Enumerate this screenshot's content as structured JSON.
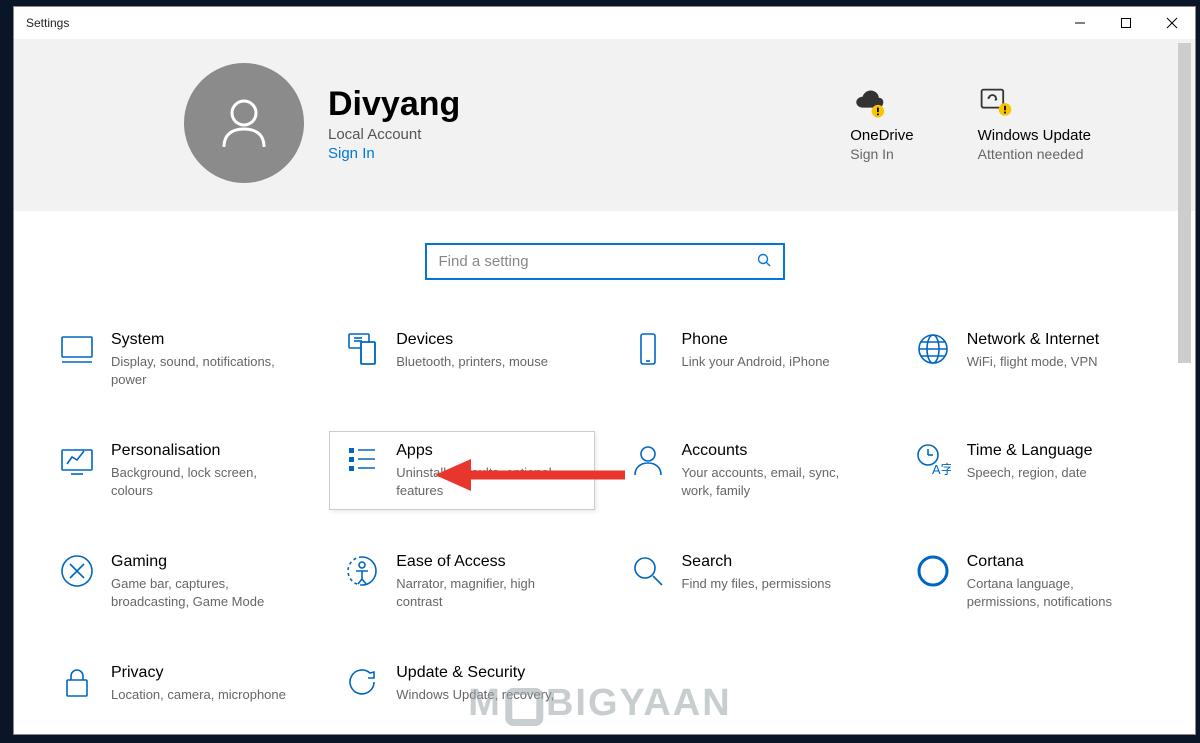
{
  "window": {
    "title": "Settings"
  },
  "user": {
    "name": "Divyang",
    "account_type": "Local Account",
    "signin_label": "Sign In"
  },
  "header_tiles": {
    "onedrive": {
      "title": "OneDrive",
      "sub": "Sign In"
    },
    "winupdate": {
      "title": "Windows Update",
      "sub": "Attention needed"
    }
  },
  "search": {
    "placeholder": "Find a setting"
  },
  "categories": {
    "system": {
      "title": "System",
      "sub": "Display, sound, notifications, power"
    },
    "devices": {
      "title": "Devices",
      "sub": "Bluetooth, printers, mouse"
    },
    "phone": {
      "title": "Phone",
      "sub": "Link your Android, iPhone"
    },
    "network": {
      "title": "Network & Internet",
      "sub": "WiFi, flight mode, VPN"
    },
    "personalisation": {
      "title": "Personalisation",
      "sub": "Background, lock screen, colours"
    },
    "apps": {
      "title": "Apps",
      "sub": "Uninstall, defaults, optional features"
    },
    "accounts": {
      "title": "Accounts",
      "sub": "Your accounts, email, sync, work, family"
    },
    "time": {
      "title": "Time & Language",
      "sub": "Speech, region, date"
    },
    "gaming": {
      "title": "Gaming",
      "sub": "Game bar, captures, broadcasting, Game Mode"
    },
    "ease": {
      "title": "Ease of Access",
      "sub": "Narrator, magnifier, high contrast"
    },
    "search": {
      "title": "Search",
      "sub": "Find my files, permissions"
    },
    "cortana": {
      "title": "Cortana",
      "sub": "Cortana language, permissions, notifications"
    },
    "privacy": {
      "title": "Privacy",
      "sub": "Location, camera, microphone"
    },
    "update": {
      "title": "Update & Security",
      "sub": "Windows Update, recovery,"
    }
  },
  "watermark": {
    "pre": "M",
    "post": "BIGYAAN"
  }
}
